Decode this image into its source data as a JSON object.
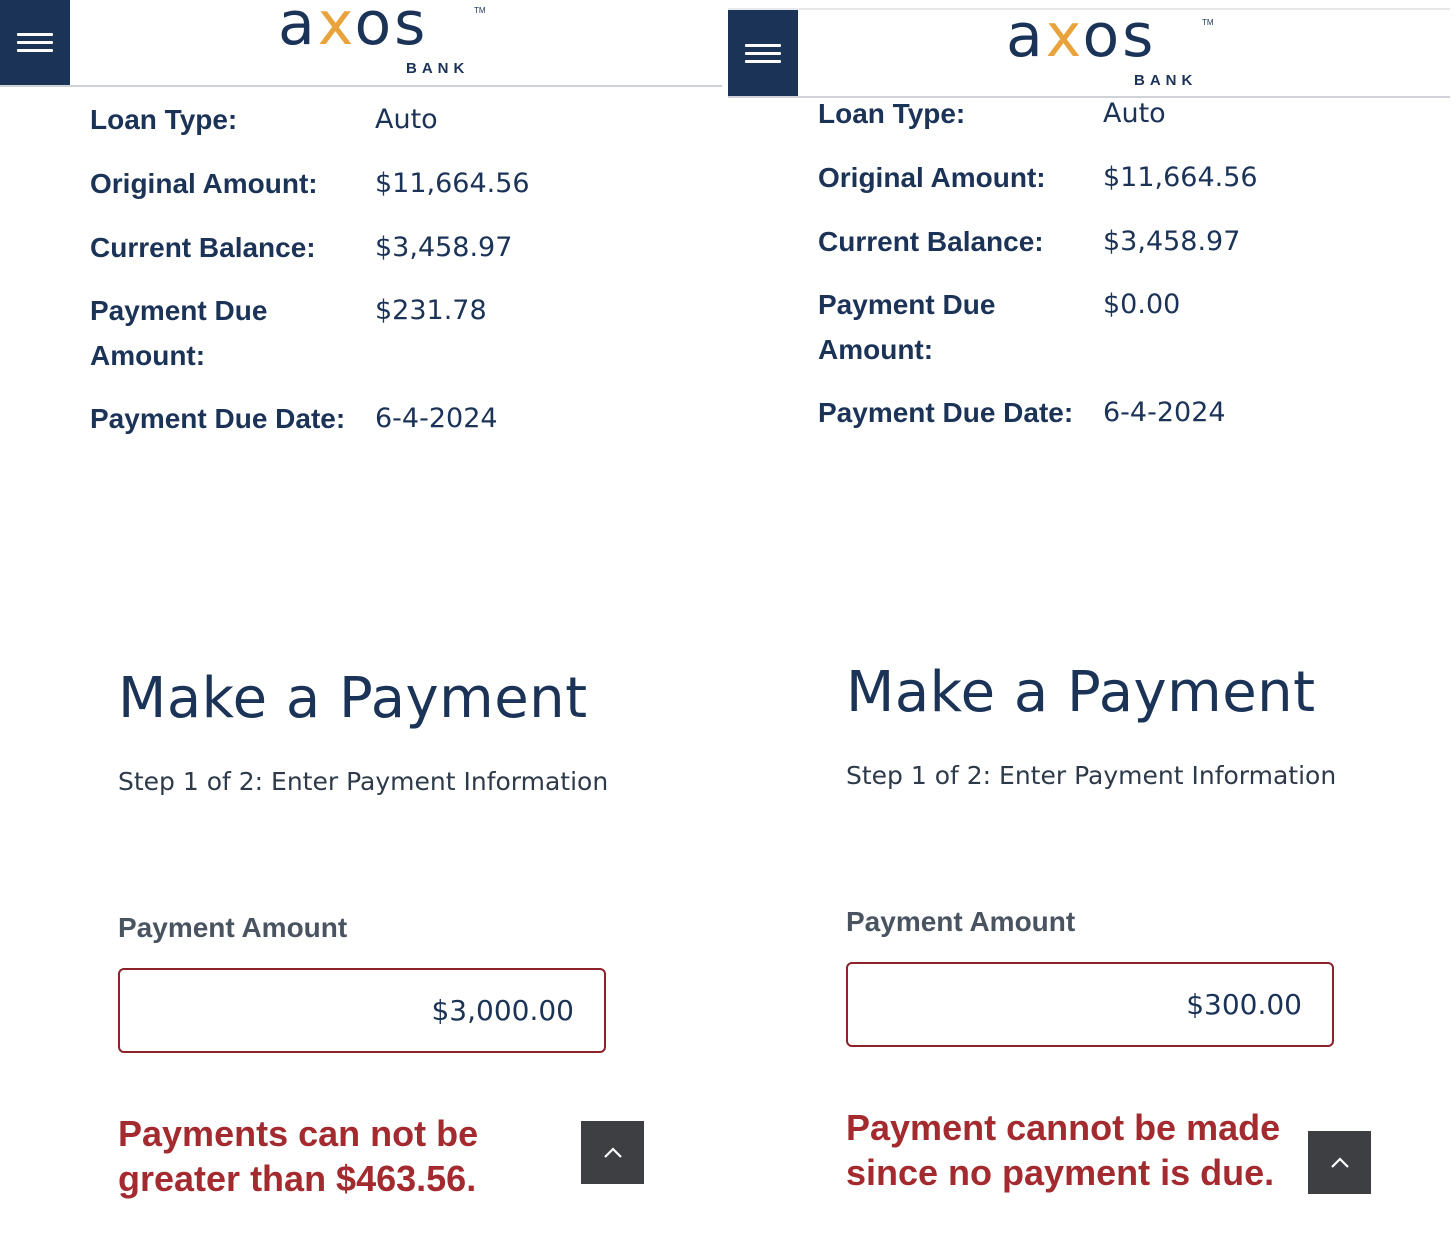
{
  "brand": {
    "wordmark": "axos",
    "sub": "BANK",
    "tm": "TM",
    "navy": "#1c3358",
    "orange": "#e8a33d"
  },
  "colors": {
    "error": "#a32a2e",
    "input_border": "#8b2328",
    "scroll_button": "#3d3f43"
  },
  "icons": {
    "menu": "hamburger-menu-icon",
    "scroll_top": "chevron-up-icon"
  },
  "left": {
    "loan_info": {
      "loan_type_label": "Loan Type:",
      "loan_type": "Auto",
      "original_amount_label": "Original Amount:",
      "original_amount": "$11,664.56",
      "current_balance_label": "Current Balance:",
      "current_balance": "$3,458.97",
      "payment_due_amount_label_1": "Payment Due",
      "payment_due_amount_label_2": "Amount:",
      "payment_due_amount": "$231.78",
      "payment_due_date_label": "Payment Due Date:",
      "payment_due_date": "6-4-2024"
    },
    "make_payment": {
      "title": "Make a Payment",
      "step": "Step 1 of 2: Enter Payment Information",
      "amount_label": "Payment Amount",
      "amount_value": "$3,000.00",
      "error_line_1": "Payments can not be",
      "error_line_2": "greater than $463.56."
    }
  },
  "right": {
    "loan_info": {
      "loan_type_label": "Loan Type:",
      "loan_type": "Auto",
      "original_amount_label": "Original Amount:",
      "original_amount": "$11,664.56",
      "current_balance_label": "Current Balance:",
      "current_balance": "$3,458.97",
      "payment_due_amount_label_1": "Payment Due",
      "payment_due_amount_label_2": "Amount:",
      "payment_due_amount": "$0.00",
      "payment_due_date_label": "Payment Due Date:",
      "payment_due_date": "6-4-2024"
    },
    "make_payment": {
      "title": "Make a Payment",
      "step": "Step 1 of 2: Enter Payment Information",
      "amount_label": "Payment Amount",
      "amount_value": "$300.00",
      "error_line_1": "Payment cannot be made",
      "error_line_2": "since no payment is due."
    }
  }
}
